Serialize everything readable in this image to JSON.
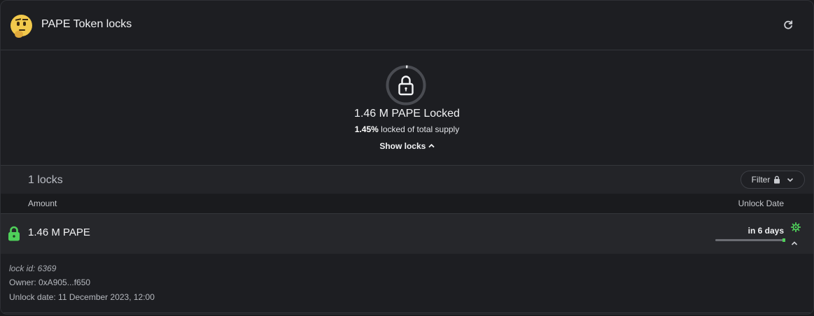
{
  "header": {
    "title": "PAPE Token locks",
    "emoji_icon": "thinking-face-icon",
    "refresh_icon": "refresh-icon"
  },
  "summary": {
    "amount_locked": "1.46 M PAPE Locked",
    "percent": "1.45%",
    "percent_suffix": " locked of total supply",
    "percent_locked_value": 1.45,
    "show_locks_label": "Show locks"
  },
  "locks": {
    "count_label": "1 locks",
    "filter_label": "Filter",
    "columns": {
      "amount": "Amount",
      "unlock_date": "Unlock Date"
    },
    "rows": [
      {
        "amount": "1.46 M PAPE",
        "unlock_in": "in 6 days",
        "details": {
          "lock_id": "lock id: 6369",
          "owner": "Owner: 0xA905...f650",
          "unlock_date": "Unlock date: 11 December 2023, 12:00"
        }
      }
    ]
  },
  "colors": {
    "accent_green": "#4fd05a",
    "background": "#1d1e22"
  }
}
